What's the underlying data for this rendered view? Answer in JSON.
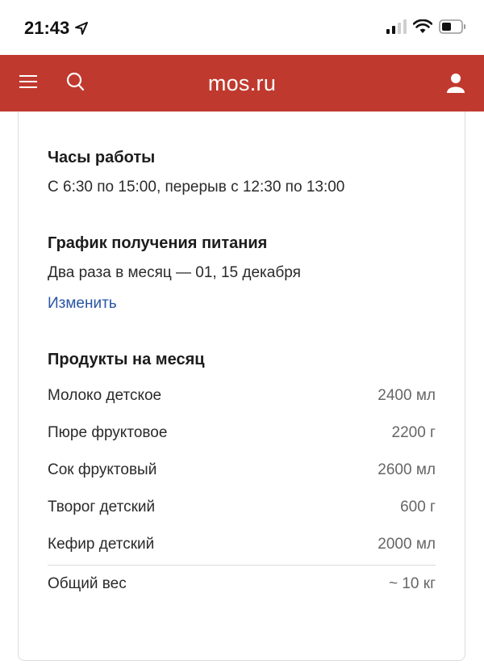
{
  "status": {
    "time": "21:43"
  },
  "header": {
    "title": "mos.ru"
  },
  "hours": {
    "title": "Часы работы",
    "text": "С 6:30 по 15:00, перерыв с 12:30 по 13:00"
  },
  "schedule": {
    "title": "График получения питания",
    "text": "Два раза в месяц — 01, 15 декабря",
    "change_link": "Изменить"
  },
  "products": {
    "title": "Продукты на месяц",
    "items": [
      {
        "name": "Молоко детское",
        "amount": "2400 мл"
      },
      {
        "name": "Пюре фруктовое",
        "amount": "2200 г"
      },
      {
        "name": "Сок фруктовый",
        "amount": "2600 мл"
      },
      {
        "name": "Творог детский",
        "amount": "600 г"
      },
      {
        "name": "Кефир детский",
        "amount": "2000 мл"
      }
    ],
    "total": {
      "name": "Общий вес",
      "amount": "~ 10 кг"
    }
  },
  "colors": {
    "header_bg": "#c0392f",
    "link": "#2a55a5"
  }
}
